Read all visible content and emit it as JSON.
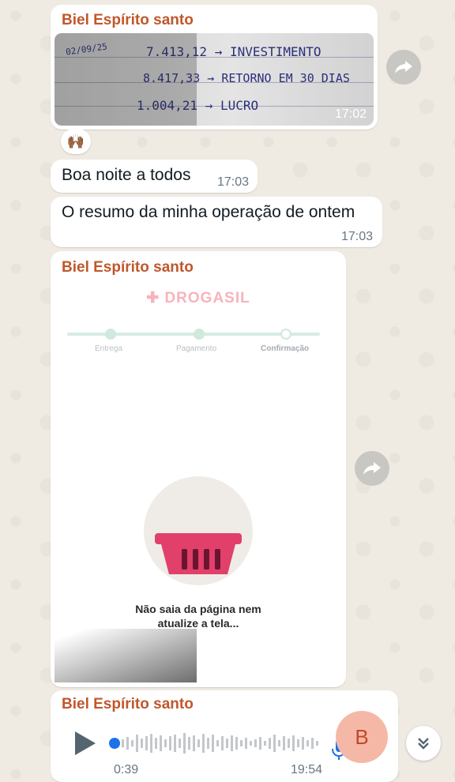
{
  "messages": {
    "sender_name": "Biel Espírito santo",
    "image_time": "17:02",
    "note_lines": [
      "02/09/25",
      "7.413,12 → INVESTIMENTO",
      "8.417,33 → RETORNO EM 30 DIAS",
      "1.004,21 → LUCRO"
    ],
    "reaction": "🙌🏾",
    "text1": "Boa noite a todos",
    "text1_time": "17:03",
    "text2": "O resumo da minha operação de ontem",
    "text2_time": "17:03",
    "screenshot": {
      "brand": "DROGASIL",
      "steps": [
        "Entrega",
        "Pagamento",
        "Confirmação"
      ],
      "message_line1": "Não saia da página nem",
      "message_line2": "atualize a tela..."
    },
    "audio_elapsed": "0:39",
    "audio_time": "19:54",
    "avatar_letter": "B"
  },
  "colors": {
    "sender": "#c0572b",
    "accent_blue": "#1a73e8",
    "avatar_bg": "#f6b8a6",
    "basket": "#e0406a"
  },
  "icons": {
    "forward": "forward-icon",
    "play": "play-icon",
    "mic": "mic-icon",
    "scroll_down": "chevrons-down-icon"
  }
}
